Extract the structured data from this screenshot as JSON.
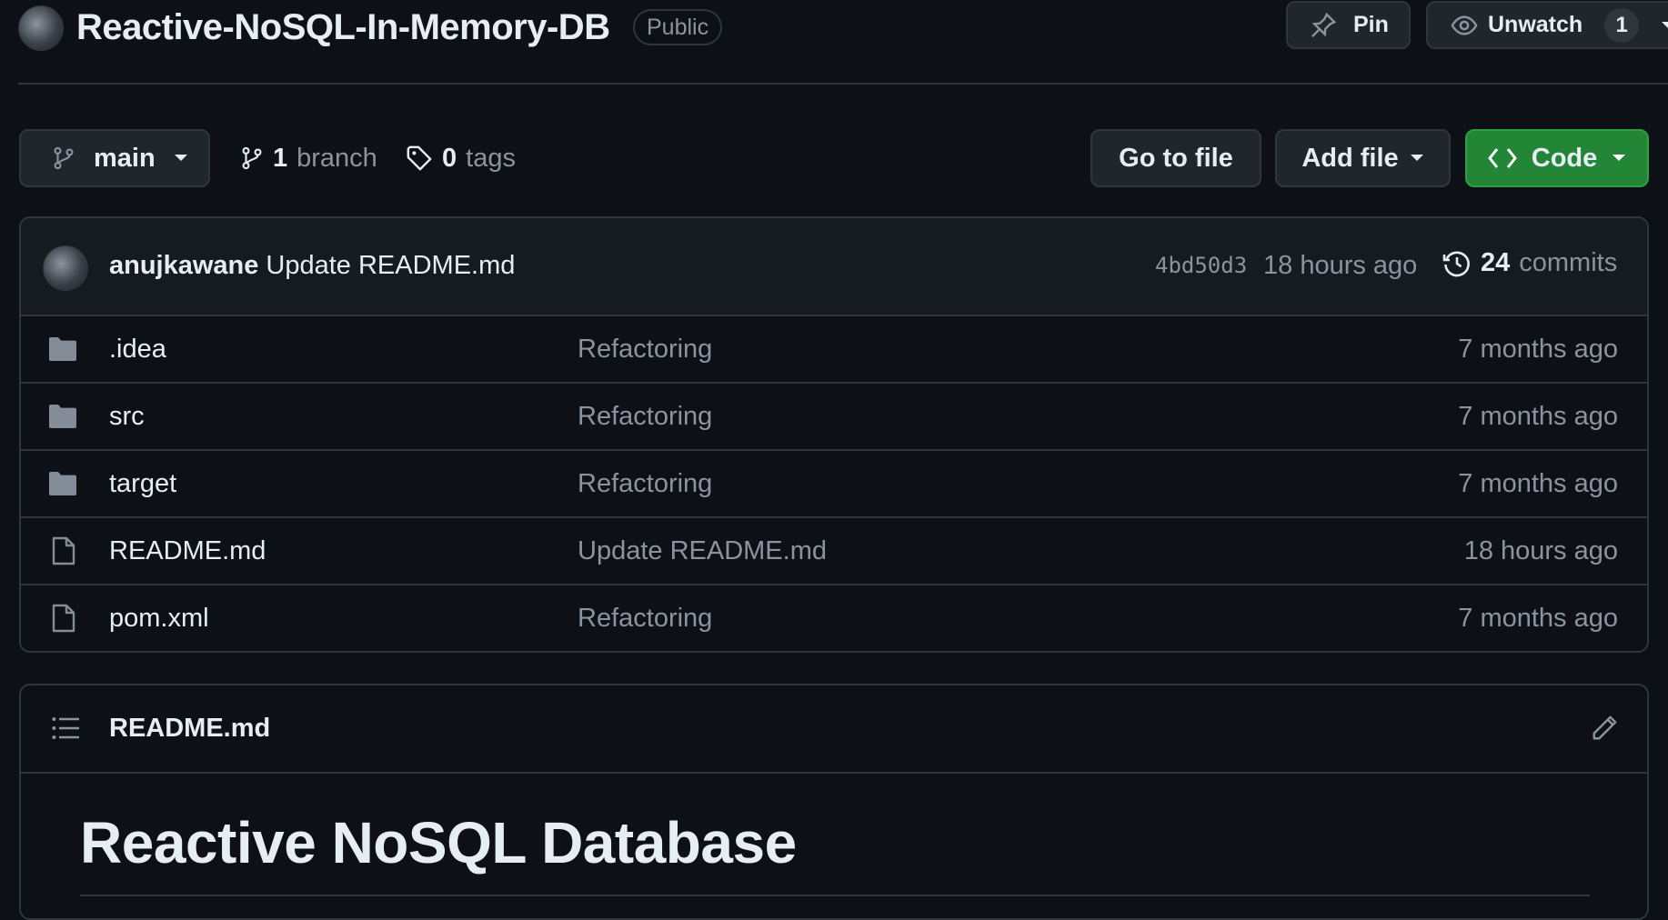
{
  "header": {
    "repo_name": "Reactive-NoSQL-In-Memory-DB",
    "visibility": "Public",
    "pin_label": "Pin",
    "unwatch_label": "Unwatch",
    "watch_count": "1"
  },
  "branch_bar": {
    "branch_name": "main",
    "branch_count": "1",
    "branch_word": "branch",
    "tag_count": "0",
    "tag_word": "tags",
    "go_to_file_label": "Go to file",
    "add_file_label": "Add file",
    "code_label": "Code"
  },
  "latest_commit": {
    "author": "anujkawane",
    "message": "Update README.md",
    "sha": "4bd50d3",
    "time": "18 hours ago",
    "commit_count": "24",
    "commit_word": "commits"
  },
  "files": [
    {
      "name": ".idea",
      "type": "folder",
      "message": "Refactoring",
      "time": "7 months ago"
    },
    {
      "name": "src",
      "type": "folder",
      "message": "Refactoring",
      "time": "7 months ago"
    },
    {
      "name": "target",
      "type": "folder",
      "message": "Refactoring",
      "time": "7 months ago"
    },
    {
      "name": "README.md",
      "type": "file",
      "message": "Update README.md",
      "time": "18 hours ago"
    },
    {
      "name": "pom.xml",
      "type": "file",
      "message": "Refactoring",
      "time": "7 months ago"
    }
  ],
  "readme": {
    "filename": "README.md",
    "heading": "Reactive NoSQL Database"
  },
  "colors": {
    "background": "#0d1117",
    "border": "#30363d",
    "button_bg": "#21262d",
    "code_button_green": "#238636",
    "muted_text": "#8b949e",
    "primary_text": "#e6edf3"
  }
}
